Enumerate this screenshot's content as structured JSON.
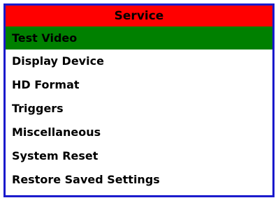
{
  "menu": {
    "title": "Service",
    "selected_index": 0,
    "colors": {
      "header_bg": "#ff0000",
      "selected_bg": "#008000",
      "border": "#1a1acc",
      "background": "#ffffff",
      "text": "#000000"
    },
    "items": [
      {
        "label": "Test Video"
      },
      {
        "label": "Display Device"
      },
      {
        "label": "HD Format"
      },
      {
        "label": "Triggers"
      },
      {
        "label": "Miscellaneous"
      },
      {
        "label": "System Reset"
      },
      {
        "label": "Restore Saved Settings"
      }
    ]
  }
}
